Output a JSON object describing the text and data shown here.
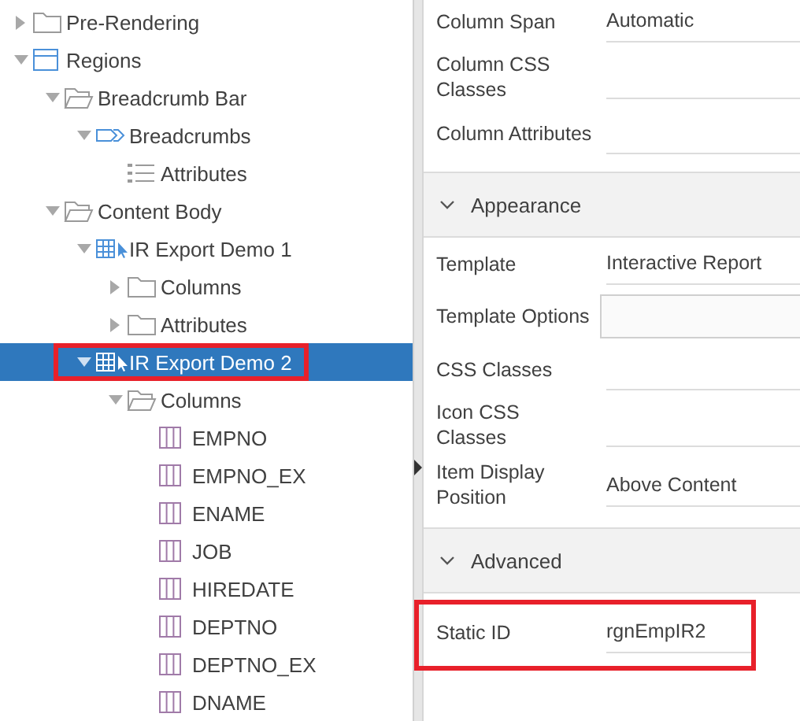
{
  "tree": [
    {
      "label": "Pre-Rendering",
      "kind": "folder",
      "expanded": false,
      "selected": false
    },
    {
      "label": "Regions",
      "kind": "region",
      "expanded": true,
      "selected": false,
      "children": [
        {
          "label": "Breadcrumb Bar",
          "kind": "open-folder",
          "expanded": true,
          "selected": false,
          "children": [
            {
              "label": "Breadcrumbs",
              "kind": "breadcrumb",
              "expanded": true,
              "selected": false,
              "children": [
                {
                  "label": "Attributes",
                  "kind": "list",
                  "selected": false
                }
              ]
            }
          ]
        },
        {
          "label": "Content Body",
          "kind": "open-folder",
          "expanded": true,
          "selected": false,
          "children": [
            {
              "label": "IR Export Demo 1",
              "kind": "report",
              "expanded": true,
              "selected": false,
              "children": [
                {
                  "label": "Columns",
                  "kind": "folder",
                  "expanded": false,
                  "selected": false
                },
                {
                  "label": "Attributes",
                  "kind": "folder",
                  "expanded": false,
                  "selected": false
                }
              ]
            },
            {
              "label": "IR Export Demo 2",
              "kind": "report",
              "expanded": true,
              "selected": true,
              "highlighted": true,
              "children": [
                {
                  "label": "Columns",
                  "kind": "open-folder",
                  "expanded": true,
                  "selected": false,
                  "children": [
                    {
                      "label": "EMPNO",
                      "kind": "column",
                      "selected": false
                    },
                    {
                      "label": "EMPNO_EX",
                      "kind": "column",
                      "selected": false
                    },
                    {
                      "label": "ENAME",
                      "kind": "column",
                      "selected": false
                    },
                    {
                      "label": "JOB",
                      "kind": "column",
                      "selected": false
                    },
                    {
                      "label": "HIREDATE",
                      "kind": "column",
                      "selected": false
                    },
                    {
                      "label": "DEPTNO",
                      "kind": "column",
                      "selected": false
                    },
                    {
                      "label": "DEPTNO_EX",
                      "kind": "column",
                      "selected": false
                    },
                    {
                      "label": "DNAME",
                      "kind": "column",
                      "selected": false
                    }
                  ]
                }
              ]
            }
          ]
        }
      ]
    }
  ],
  "properties": [
    {
      "rows": [
        {
          "label": "Column Span",
          "value": "Automatic",
          "kind": "text"
        },
        {
          "label": "Column CSS Classes",
          "kind": "text"
        },
        {
          "label": "Column Attributes",
          "kind": "text"
        }
      ]
    },
    {
      "title": "Appearance",
      "expanded": true,
      "rows": [
        {
          "label": "Template",
          "value": "Interactive Report",
          "kind": "text"
        },
        {
          "label": "Template Options",
          "kind": "box"
        },
        {
          "label": "CSS Classes",
          "kind": "text"
        },
        {
          "label": "Icon CSS Classes",
          "kind": "text"
        },
        {
          "label": "Item Display Position",
          "value": "Above Content",
          "kind": "text"
        }
      ]
    },
    {
      "title": "Advanced",
      "expanded": true,
      "rows": [
        {
          "label": "Static ID",
          "value": "rgnEmpIR2",
          "kind": "text",
          "highlighted": true
        }
      ]
    }
  ]
}
